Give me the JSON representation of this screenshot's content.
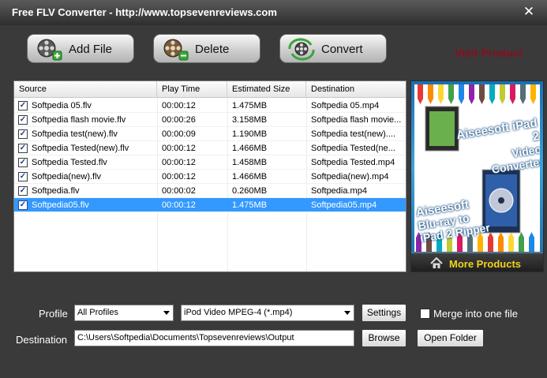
{
  "window": {
    "title": "Free FLV Converter - http://www.topsevenreviews.com",
    "close": "✕"
  },
  "toolbar": {
    "add_label": "Add File",
    "delete_label": "Delete",
    "convert_label": "Convert",
    "visit_label": "Visit Product"
  },
  "file_list": {
    "columns": [
      "Source",
      "Play Time",
      "Estimated Size",
      "Destination"
    ],
    "rows": [
      {
        "source": "Softpedia 05.flv",
        "time": "00:00:12",
        "size": "1.475MB",
        "dest": "Softpedia 05.mp4",
        "checked": true,
        "selected": false
      },
      {
        "source": "Softpedia flash movie.flv",
        "time": "00:00:26",
        "size": "3.158MB",
        "dest": "Softpedia flash movie...",
        "checked": true,
        "selected": false
      },
      {
        "source": "Softpedia test(new).flv",
        "time": "00:00:09",
        "size": "1.190MB",
        "dest": "Softpedia test(new)....",
        "checked": true,
        "selected": false
      },
      {
        "source": "Softpedia Tested(new).flv",
        "time": "00:00:12",
        "size": "1.466MB",
        "dest": "Softpedia Tested(ne...",
        "checked": true,
        "selected": false
      },
      {
        "source": "Softpedia Tested.flv",
        "time": "00:00:12",
        "size": "1.458MB",
        "dest": "Softpedia Tested.mp4",
        "checked": true,
        "selected": false
      },
      {
        "source": "Softpedia(new).flv",
        "time": "00:00:12",
        "size": "1.466MB",
        "dest": "Softpedia(new).mp4",
        "checked": true,
        "selected": false
      },
      {
        "source": "Softpedia.flv",
        "time": "00:00:02",
        "size": "0.260MB",
        "dest": "Softpedia.mp4",
        "checked": true,
        "selected": false
      },
      {
        "source": "Softpedia05.flv",
        "time": "00:00:12",
        "size": "1.475MB",
        "dest": "Softpedia05.mp4",
        "checked": true,
        "selected": true
      }
    ]
  },
  "ad": {
    "line1_brand": "Aiseesoft iPad 2",
    "line1_product": "Video Converter",
    "line2_brand": "Aiseesoft",
    "line2_product": "Blu-ray to",
    "line2_product2": "iPad 2 Ripper",
    "more_products": "More Products"
  },
  "output": {
    "profile_label": "Profile",
    "profile_value": "All Profiles",
    "format_value": "iPod Video MPEG-4 (*.mp4)",
    "settings_label": "Settings",
    "merge_label": "Merge into one file",
    "merge_checked": false,
    "destination_label": "Destination",
    "destination_value": "C:\\Users\\Softpedia\\Documents\\Topsevenreviews\\Output",
    "browse_label": "Browse",
    "open_folder_label": "Open Folder"
  }
}
